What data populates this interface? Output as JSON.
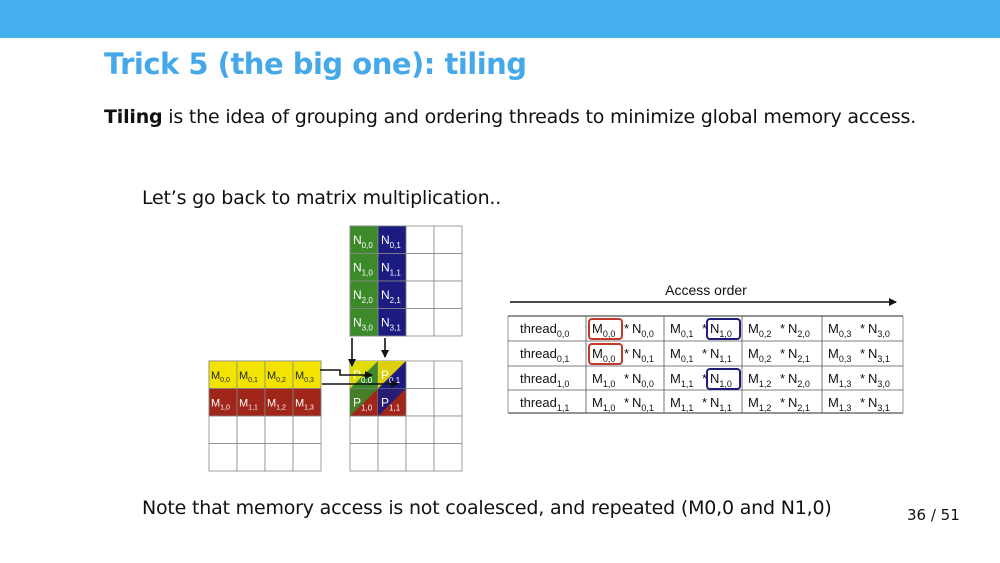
{
  "header": {
    "title": "Trick 5 (the big one): tiling"
  },
  "intro": {
    "term": "Tiling",
    "rest": " is the idea of grouping and ordering threads to minimize global memory access."
  },
  "lead": "Let’s go back to matrix multiplication..",
  "note": "Note that memory access is not coalesced, and repeated (M0,0 and N1,0)",
  "page_number": "36 / 51",
  "colors": {
    "topbar": "#45b0ee",
    "title": "#45a8e8",
    "cell_green": "#3d8a2a",
    "cell_navy": "#1c1c80",
    "cell_yellow": "#f2e400",
    "cell_red": "#a0261a",
    "highlight_red": "#c0392b",
    "highlight_navy": "#1e1e7a"
  },
  "diagram": {
    "n_column0": [
      {
        "base": "N",
        "sub": "0,0"
      },
      {
        "base": "N",
        "sub": "1,0"
      },
      {
        "base": "N",
        "sub": "2,0"
      },
      {
        "base": "N",
        "sub": "3,0"
      }
    ],
    "n_column1": [
      {
        "base": "N",
        "sub": "0,1"
      },
      {
        "base": "N",
        "sub": "1,1"
      },
      {
        "base": "N",
        "sub": "2,1"
      },
      {
        "base": "N",
        "sub": "3,1"
      }
    ],
    "m_row0": [
      {
        "base": "M",
        "sub": "0,0"
      },
      {
        "base": "M",
        "sub": "0,1"
      },
      {
        "base": "M",
        "sub": "0,2"
      },
      {
        "base": "M",
        "sub": "0,3"
      }
    ],
    "m_row1": [
      {
        "base": "M",
        "sub": "1,0"
      },
      {
        "base": "M",
        "sub": "1,1"
      },
      {
        "base": "M",
        "sub": "1,2"
      },
      {
        "base": "M",
        "sub": "1,3"
      }
    ],
    "p_cells": [
      [
        {
          "base": "P",
          "sub": "0,0"
        },
        {
          "base": "P",
          "sub": "0,1"
        }
      ],
      [
        {
          "base": "P",
          "sub": "1,0"
        },
        {
          "base": "P",
          "sub": "1,1"
        }
      ]
    ]
  },
  "access_table": {
    "header": "Access order",
    "rows": [
      {
        "thread": {
          "base": "thread",
          "sub": "0,0"
        },
        "cells": [
          {
            "a": {
              "base": "M",
              "sub": "0,0"
            },
            "b": {
              "base": "N",
              "sub": "0,0"
            },
            "box_a": "red",
            "box_b": ""
          },
          {
            "a": {
              "base": "M",
              "sub": "0,1"
            },
            "b": {
              "base": "N",
              "sub": "1,0"
            },
            "box_a": "",
            "box_b": "navy"
          },
          {
            "a": {
              "base": "M",
              "sub": "0,2"
            },
            "b": {
              "base": "N",
              "sub": "2,0"
            },
            "box_a": "",
            "box_b": ""
          },
          {
            "a": {
              "base": "M",
              "sub": "0,3"
            },
            "b": {
              "base": "N",
              "sub": "3,0"
            },
            "box_a": "",
            "box_b": ""
          }
        ]
      },
      {
        "thread": {
          "base": "thread",
          "sub": "0,1"
        },
        "cells": [
          {
            "a": {
              "base": "M",
              "sub": "0,0"
            },
            "b": {
              "base": "N",
              "sub": "0,1"
            },
            "box_a": "red",
            "box_b": ""
          },
          {
            "a": {
              "base": "M",
              "sub": "0,1"
            },
            "b": {
              "base": "N",
              "sub": "1,1"
            },
            "box_a": "",
            "box_b": ""
          },
          {
            "a": {
              "base": "M",
              "sub": "0,2"
            },
            "b": {
              "base": "N",
              "sub": "2,1"
            },
            "box_a": "",
            "box_b": ""
          },
          {
            "a": {
              "base": "M",
              "sub": "0,3"
            },
            "b": {
              "base": "N",
              "sub": "3,1"
            },
            "box_a": "",
            "box_b": ""
          }
        ]
      },
      {
        "thread": {
          "base": "thread",
          "sub": "1,0"
        },
        "cells": [
          {
            "a": {
              "base": "M",
              "sub": "1,0"
            },
            "b": {
              "base": "N",
              "sub": "0,0"
            },
            "box_a": "",
            "box_b": ""
          },
          {
            "a": {
              "base": "M",
              "sub": "1,1"
            },
            "b": {
              "base": "N",
              "sub": "1,0"
            },
            "box_a": "",
            "box_b": "navy"
          },
          {
            "a": {
              "base": "M",
              "sub": "1,2"
            },
            "b": {
              "base": "N",
              "sub": "2,0"
            },
            "box_a": "",
            "box_b": ""
          },
          {
            "a": {
              "base": "M",
              "sub": "1,3"
            },
            "b": {
              "base": "N",
              "sub": "3,0"
            },
            "box_a": "",
            "box_b": ""
          }
        ]
      },
      {
        "thread": {
          "base": "thread",
          "sub": "1,1"
        },
        "cells": [
          {
            "a": {
              "base": "M",
              "sub": "1,0"
            },
            "b": {
              "base": "N",
              "sub": "0,1"
            },
            "box_a": "",
            "box_b": ""
          },
          {
            "a": {
              "base": "M",
              "sub": "1,1"
            },
            "b": {
              "base": "N",
              "sub": "1,1"
            },
            "box_a": "",
            "box_b": ""
          },
          {
            "a": {
              "base": "M",
              "sub": "1,2"
            },
            "b": {
              "base": "N",
              "sub": "2,1"
            },
            "box_a": "",
            "box_b": ""
          },
          {
            "a": {
              "base": "M",
              "sub": "1,3"
            },
            "b": {
              "base": "N",
              "sub": "3,1"
            },
            "box_a": "",
            "box_b": ""
          }
        ]
      }
    ]
  }
}
